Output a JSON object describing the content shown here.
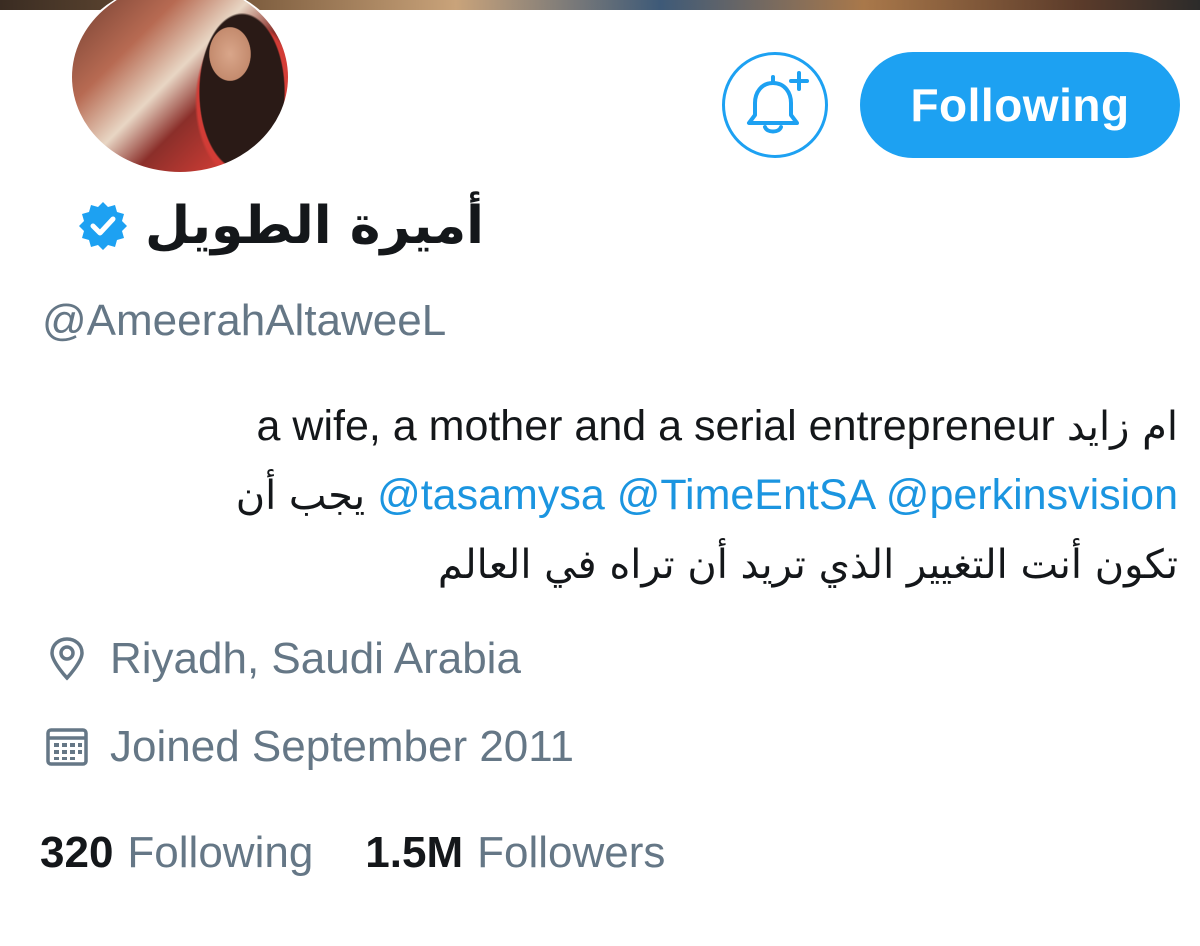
{
  "profile": {
    "display_name": "أميرة الطويل",
    "handle": "@AmeerahAltaweeL",
    "verified": true,
    "follow_button_label": "Following",
    "notification_icon": "bell-plus-icon",
    "bio": {
      "line1_text": "a wife, a mother and a serial entrepreneur",
      "line1_arabic": "ام زايد",
      "line2_arabic": "يجب أن",
      "mention_1": "@tasamysa",
      "mention_2": "@TimeEntSA",
      "mention_3": "@perkinsvision",
      "line3_arabic": "تكون أنت التغيير الذي تريد أن تراه في العالم"
    },
    "location": "Riyadh, Saudi Arabia",
    "joined": "Joined September 2011",
    "stats": {
      "following_count": "320",
      "following_label": "Following",
      "followers_count": "1.5M",
      "followers_label": "Followers"
    }
  },
  "colors": {
    "accent": "#1da1f2",
    "mention": "#1b95e0",
    "secondary_text": "#657786",
    "primary_text": "#14171a"
  }
}
